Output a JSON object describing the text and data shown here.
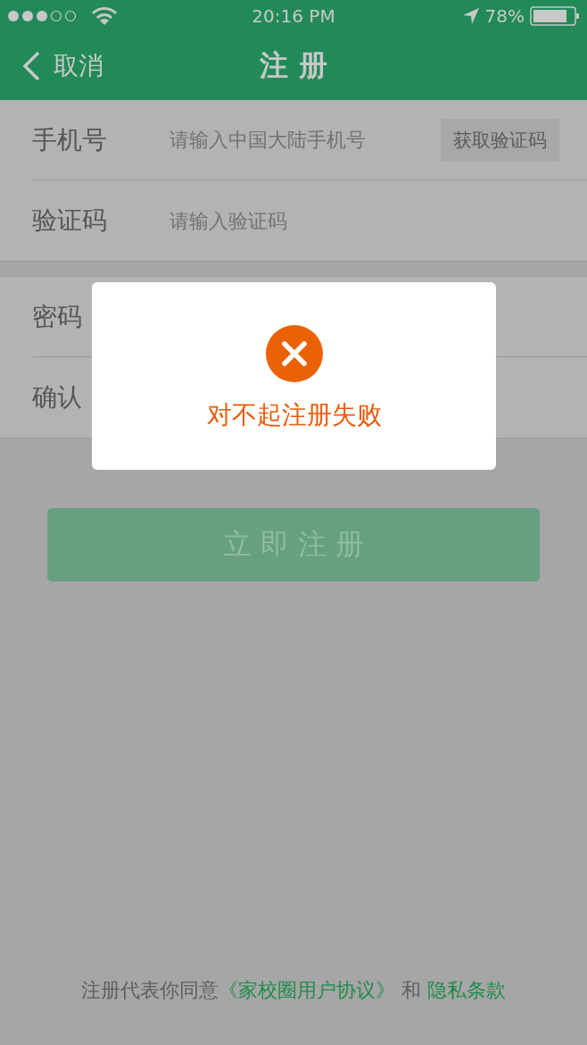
{
  "status_bar": {
    "time": "20:16 PM",
    "battery": "78%"
  },
  "nav": {
    "back": "取消",
    "title": "注 册"
  },
  "sections": [
    [
      {
        "label": "手机号",
        "placeholder": "请输入中国大陆手机号",
        "action": "获取验证码"
      },
      {
        "label": "验证码",
        "placeholder": "请输入验证码"
      }
    ],
    [
      {
        "label": "密码"
      },
      {
        "label": "确认"
      }
    ]
  ],
  "submit": {
    "label": "立 即 注 册",
    "disabled": true
  },
  "footer": {
    "text": "注册代表你同意",
    "agreement": "《家校圈用户协议》",
    "conjunction": "和",
    "privacy": "隐私条款"
  },
  "dialog": {
    "message": "对不起注册失败"
  }
}
